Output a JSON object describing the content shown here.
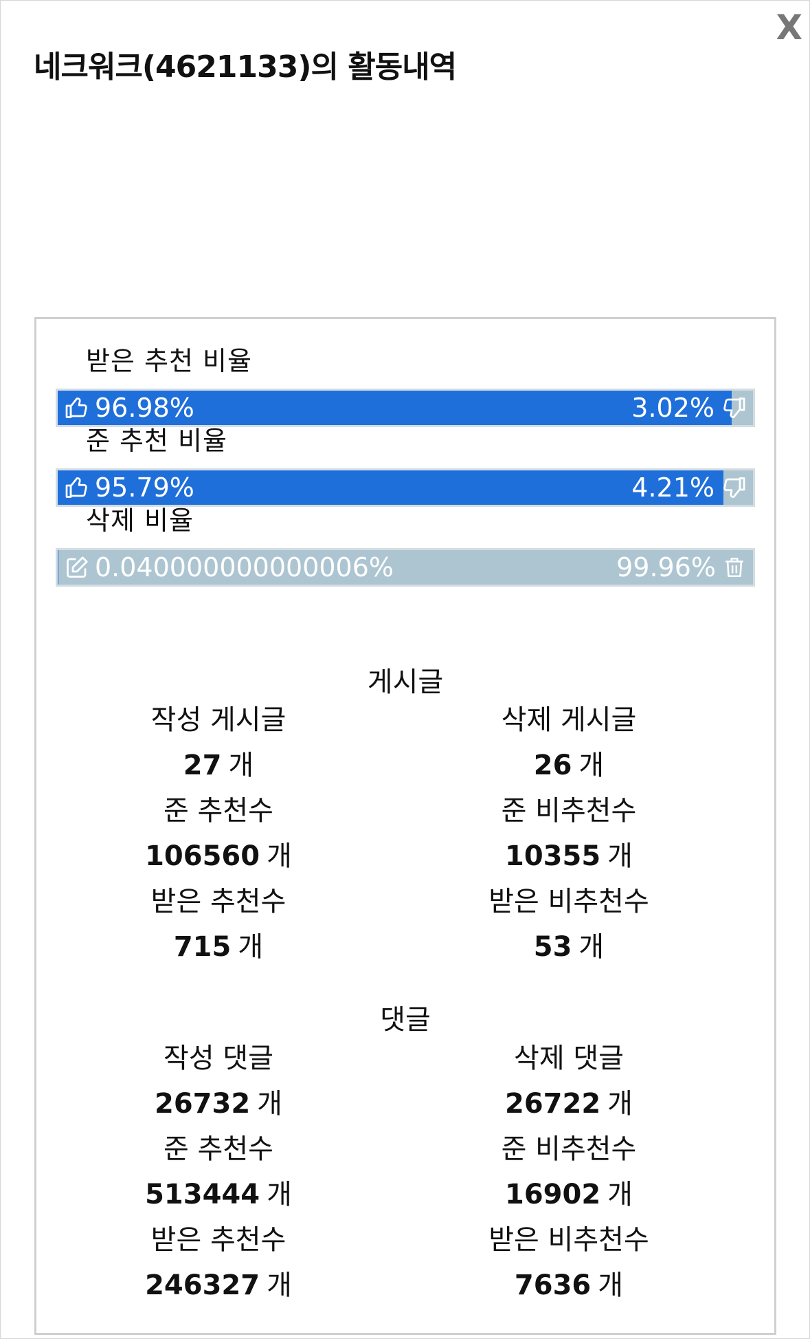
{
  "modal": {
    "title": "네크워크(4621133)의 활동내역",
    "close_label": "X"
  },
  "ratios": [
    {
      "label": "받은 추천 비율",
      "left_text": "96.98%",
      "right_text": "3.02%",
      "fill_percent": 96.98,
      "left_icon": "thumbs-up-icon",
      "right_icon": "thumbs-down-icon"
    },
    {
      "label": "준 추천 비율",
      "left_text": "95.79%",
      "right_text": "4.21%",
      "fill_percent": 95.79,
      "left_icon": "thumbs-up-icon",
      "right_icon": "thumbs-down-icon"
    },
    {
      "label": "삭제 비율",
      "left_text": "0.040000000000006%",
      "right_text": "99.96%",
      "fill_percent": 0.040000000000006,
      "left_icon": "edit-icon",
      "right_icon": "trash-icon"
    }
  ],
  "unit": "개",
  "posts": {
    "title": "게시글",
    "left": [
      {
        "label": "작성 게시글",
        "value": "27"
      },
      {
        "label": "준 추천수",
        "value": "106560"
      },
      {
        "label": "받은 추천수",
        "value": "715"
      }
    ],
    "right": [
      {
        "label": "삭제 게시글",
        "value": "26"
      },
      {
        "label": "준 비추천수",
        "value": "10355"
      },
      {
        "label": "받은 비추천수",
        "value": "53"
      }
    ]
  },
  "comments": {
    "title": "댓글",
    "left": [
      {
        "label": "작성 댓글",
        "value": "26732"
      },
      {
        "label": "준 추천수",
        "value": "513444"
      },
      {
        "label": "받은 추천수",
        "value": "246327"
      }
    ],
    "right": [
      {
        "label": "삭제 댓글",
        "value": "26722"
      },
      {
        "label": "준 비추천수",
        "value": "16902"
      },
      {
        "label": "받은 비추천수",
        "value": "7636"
      }
    ]
  },
  "colors": {
    "bar_fill": "#1f6fdb",
    "bar_track": "#adc5d1"
  }
}
